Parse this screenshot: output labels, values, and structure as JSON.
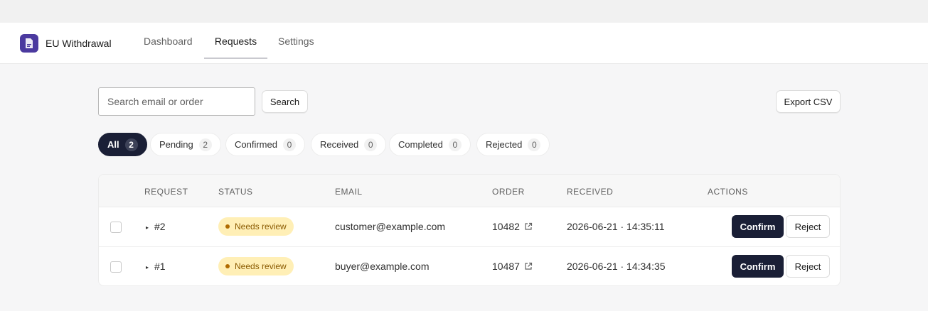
{
  "app": {
    "name": "EU Withdrawal"
  },
  "nav": {
    "tabs": [
      "Dashboard",
      "Requests",
      "Settings"
    ]
  },
  "toolbar": {
    "search_placeholder": "Search email or order",
    "search_label": "Search",
    "export_label": "Export CSV"
  },
  "filters": [
    {
      "label": "All",
      "count": "2"
    },
    {
      "label": "Pending",
      "count": "2"
    },
    {
      "label": "Confirmed",
      "count": "0"
    },
    {
      "label": "Received",
      "count": "0"
    },
    {
      "label": "Completed",
      "count": "0"
    },
    {
      "label": "Rejected",
      "count": "0"
    }
  ],
  "table": {
    "headers": [
      "REQUEST",
      "STATUS",
      "EMAIL",
      "ORDER",
      "RECEIVED",
      "ACTIONS"
    ],
    "rows": [
      {
        "request": "#2",
        "status": "Needs review",
        "email": "customer@example.com",
        "order": "10482",
        "received": "2026-06-21 · 14:35:11",
        "confirm": "Confirm",
        "reject": "Reject"
      },
      {
        "request": "#1",
        "status": "Needs review",
        "email": "buyer@example.com",
        "order": "10487",
        "received": "2026-06-21 · 14:34:35",
        "confirm": "Confirm",
        "reject": "Reject"
      }
    ]
  },
  "colors": {
    "accent": "#1a1f36",
    "brand": "#4b3a9f",
    "badge_bg": "#ffefb6",
    "badge_text": "#8a5a00"
  }
}
